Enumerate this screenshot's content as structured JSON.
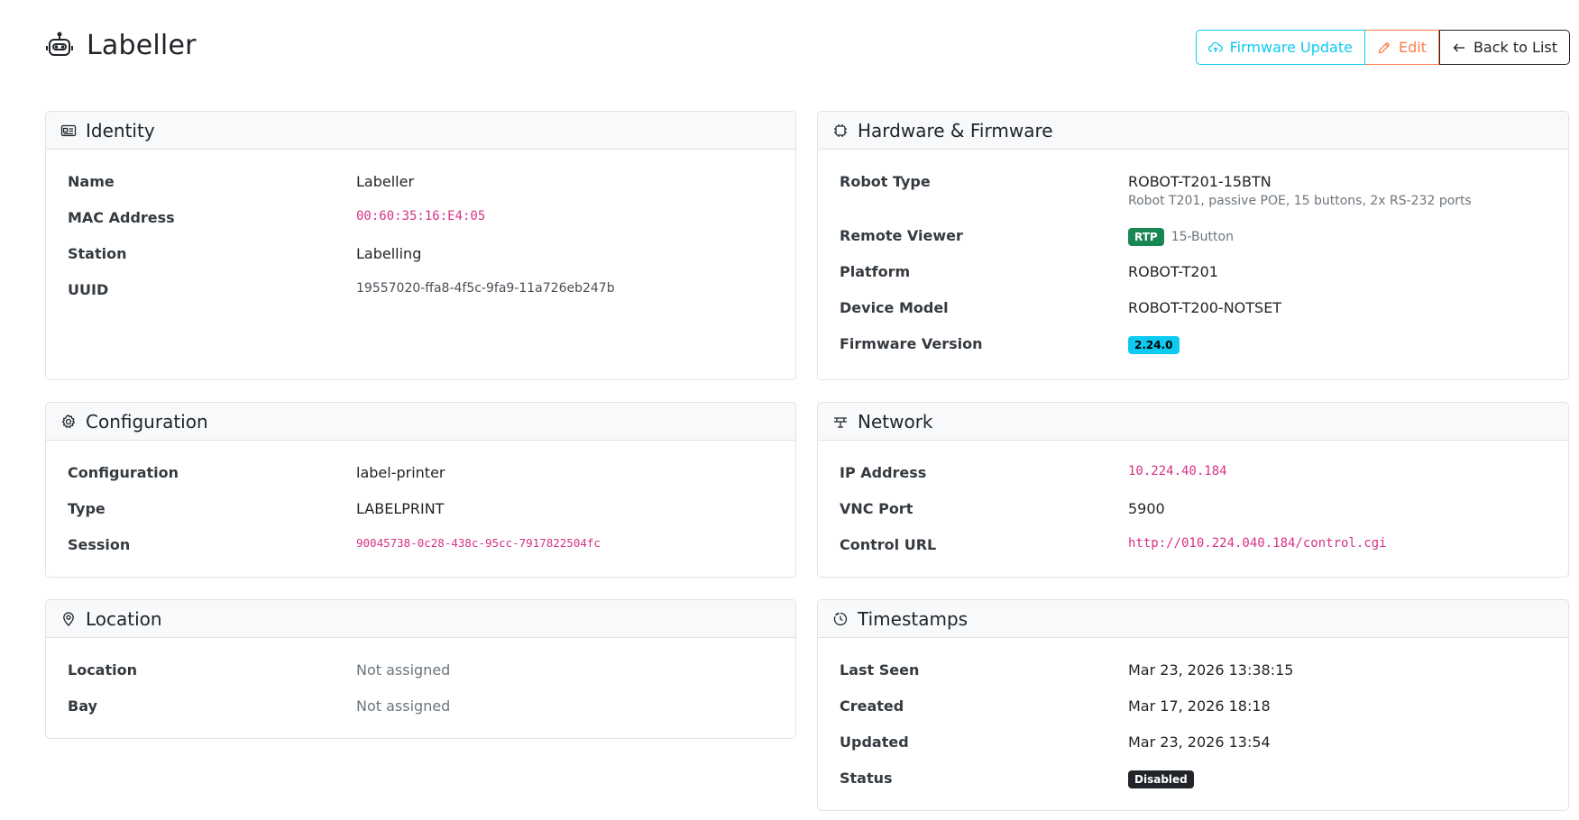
{
  "page": {
    "title": "Labeller"
  },
  "actions": {
    "firmware_update": "Firmware Update",
    "edit": "Edit",
    "back": "Back to List"
  },
  "identity": {
    "title": "Identity",
    "rows": [
      {
        "label": "Name",
        "value": "Labeller"
      },
      {
        "label": "MAC Address",
        "value": "00:60:35:16:E4:05"
      },
      {
        "label": "Station",
        "value": "Labelling"
      },
      {
        "label": "UUID",
        "value": "19557020-ffa8-4f5c-9fa9-11a726eb247b"
      }
    ]
  },
  "hardware": {
    "title": "Hardware & Firmware",
    "robot_type_label": "Robot Type",
    "robot_type": "ROBOT-T201-15BTN",
    "robot_type_desc": "Robot T201, passive POE, 15 buttons, 2x RS-232 ports",
    "remote_viewer_label": "Remote Viewer",
    "remote_viewer_badge": "RTP",
    "remote_viewer_note": "15-Button",
    "platform_label": "Platform",
    "platform": "ROBOT-T201",
    "device_model_label": "Device Model",
    "device_model": "ROBOT-T200-NOTSET",
    "firmware_label": "Firmware Version",
    "firmware": "2.24.0"
  },
  "configuration": {
    "title": "Configuration",
    "rows": [
      {
        "label": "Configuration",
        "value": "label-printer"
      },
      {
        "label": "Type",
        "value": "LABELPRINT"
      },
      {
        "label": "Session",
        "value": "90045738-0c28-438c-95cc-7917822504fc"
      }
    ]
  },
  "network": {
    "title": "Network",
    "rows": [
      {
        "label": "IP Address",
        "value": "10.224.40.184"
      },
      {
        "label": "VNC Port",
        "value": "5900"
      },
      {
        "label": "Control URL",
        "value": "http://010.224.040.184/control.cgi"
      }
    ]
  },
  "location": {
    "title": "Location",
    "rows": [
      {
        "label": "Location",
        "value": "Not assigned"
      },
      {
        "label": "Bay",
        "value": "Not assigned"
      }
    ]
  },
  "timestamps": {
    "title": "Timestamps",
    "rows": [
      {
        "label": "Last Seen",
        "value": "Mar 23, 2026 13:38:15"
      },
      {
        "label": "Created",
        "value": "Mar 17, 2026 18:18"
      },
      {
        "label": "Updated",
        "value": "Mar 23, 2026 13:54"
      },
      {
        "label": "Status",
        "value": "Disabled"
      }
    ]
  },
  "colors": {
    "info": "#0dcaf0",
    "warning": "#fd7e4b",
    "success": "#198754",
    "code": "#d63384",
    "dark": "#212529"
  }
}
